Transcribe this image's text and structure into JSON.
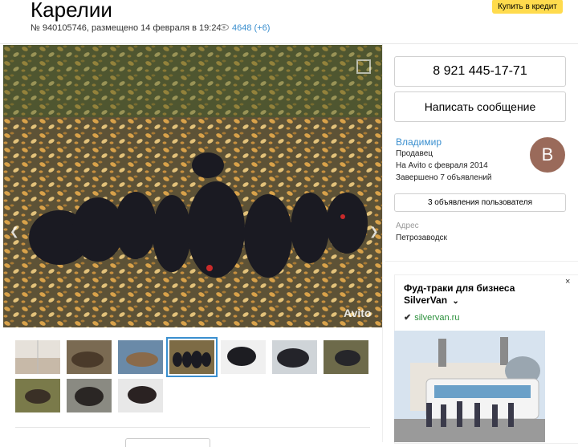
{
  "listing": {
    "title": "Карелии",
    "meta": "№ 940105746, размещено 14 февраля в 19:24",
    "views": "4648 (+6)",
    "credit_button": "Купить в кредит",
    "photo_watermark": "Avito"
  },
  "seller": {
    "phone": "8 921 445-17-71",
    "write_message": "Написать сообщение",
    "name": "Владимир",
    "role": "Продавец",
    "since": "На Avito с февраля 2014",
    "completed": "Завершено 7 объявлений",
    "avatar_letter": "В",
    "user_ads_button": "3 объявления пользователя",
    "address_label": "Адрес",
    "address_value": "Петрозаводск"
  },
  "ad": {
    "title": "Фуд-траки для бизнеса SilverVan",
    "domain": "silvervan.ru",
    "close": "×"
  },
  "colors": {
    "accent": "#3a8fcf",
    "credit_yellow": "#ffdb4d",
    "avatar_bg": "#9a6a5a",
    "ad_green": "#2a8f3a"
  },
  "icons": [
    "eye-icon",
    "arrow-left-icon",
    "arrow-right-icon",
    "fullscreen-icon",
    "chevron-down-icon",
    "close-icon",
    "ad-logo-icon"
  ]
}
